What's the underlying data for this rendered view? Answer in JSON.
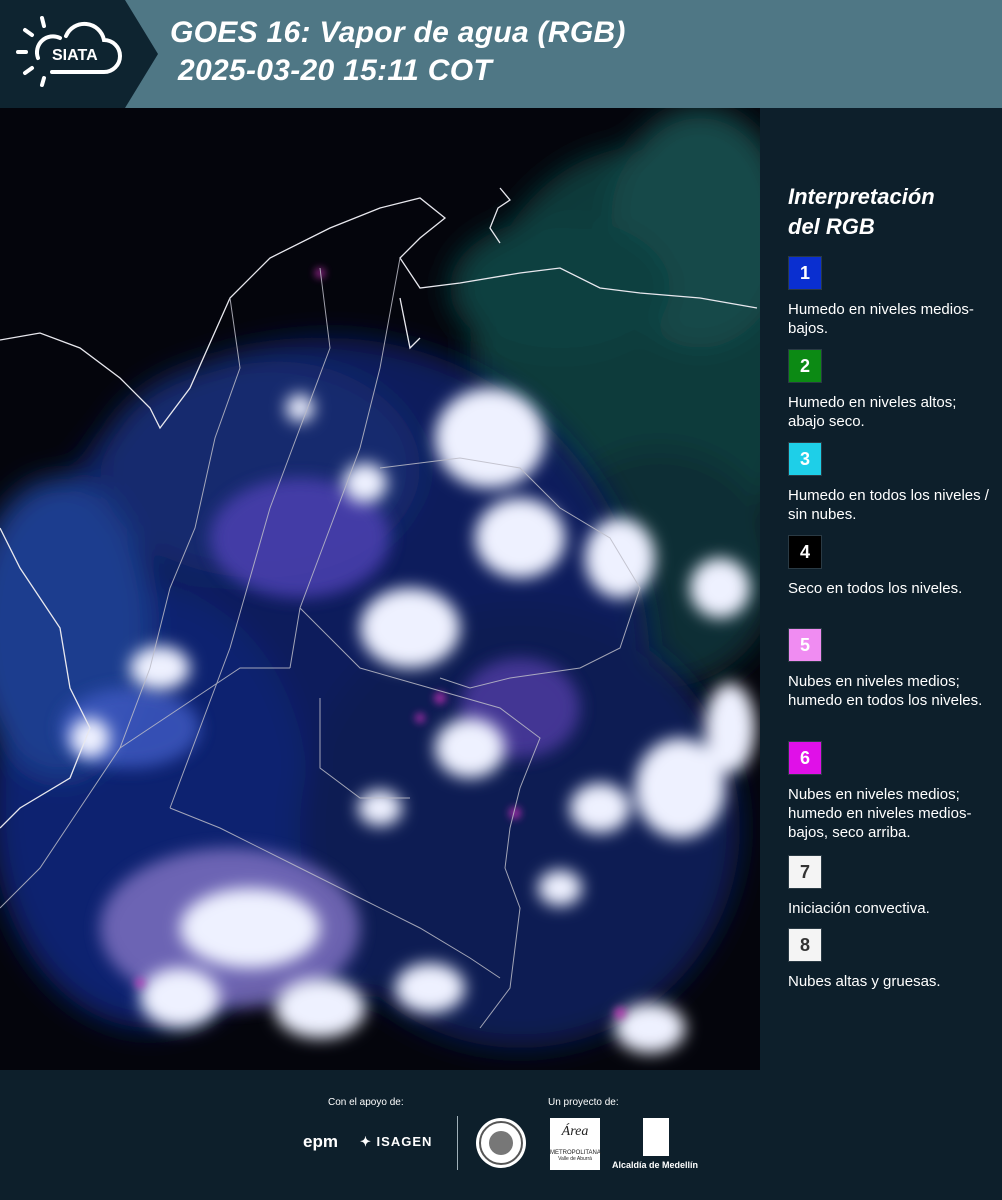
{
  "header": {
    "logo_text": "SIATA",
    "title_line1": "GOES 16: Vapor de agua (RGB)",
    "title_line2": "2025-03-20 15:11 COT"
  },
  "map": {
    "description_icon": "satellite-water-vapor-rgb-map"
  },
  "legend": {
    "title_line1": "Interpretación",
    "title_line2": "del RGB",
    "items": [
      {
        "num": "1",
        "color": "#0a2fd0",
        "text_color": "#ffffff",
        "text": "Humedo en niveles medios-bajos."
      },
      {
        "num": "2",
        "color": "#0c8a14",
        "text_color": "#ffffff",
        "text": "Humedo en niveles altos; abajo seco."
      },
      {
        "num": "3",
        "color": "#1ecfe8",
        "text_color": "#ffffff",
        "text": "Humedo en todos los niveles / sin nubes."
      },
      {
        "num": "4",
        "color": "#000000",
        "text_color": "#ffffff",
        "text": "Seco en todos los niveles."
      },
      {
        "num": "5",
        "color": "#f08cf2",
        "text_color": "#ffffff",
        "text": "Nubes en niveles medios; humedo en todos los niveles."
      },
      {
        "num": "6",
        "color": "#e010e8",
        "text_color": "#ffffff",
        "text": "Nubes en niveles medios; humedo en niveles medios-bajos, seco arriba."
      },
      {
        "num": "7",
        "color": "#f4f4f4",
        "text_color": "#333333",
        "text": "Iniciación convectiva."
      },
      {
        "num": "8",
        "color": "#f4f4f4",
        "text_color": "#333333",
        "text": "Nubes altas y gruesas."
      }
    ]
  },
  "footer": {
    "support_label": "Con el apoyo de:",
    "project_label": "Un proyecto de:",
    "epm_text": "epm",
    "isagen_text": "ISAGEN",
    "area_text": "Área",
    "area_sub": "METROPOLITANA",
    "area_sub2": "Valle de Aburrá",
    "alcaldia_text": "Alcaldía de Medellín"
  }
}
